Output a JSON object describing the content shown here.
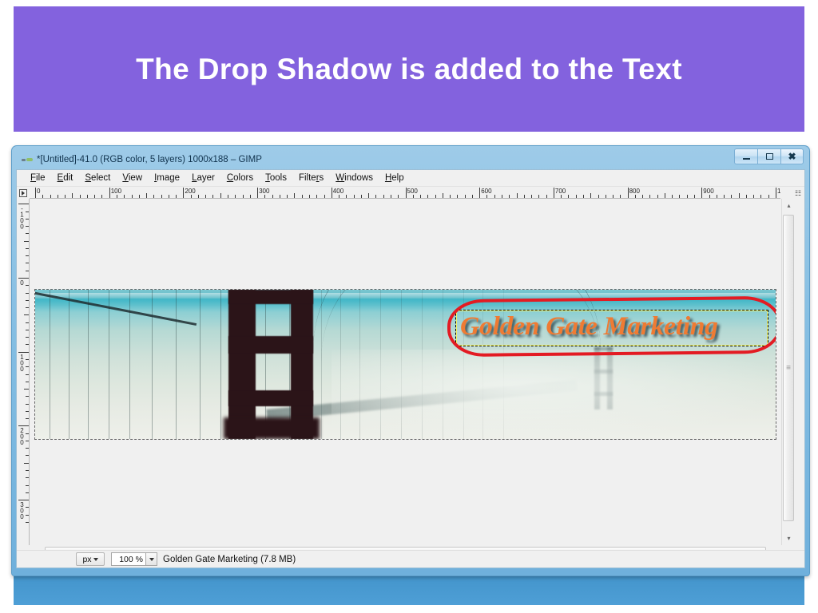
{
  "slide": {
    "title": "The Drop Shadow is added to the Text",
    "band_color": "#8362de",
    "footer_color": "#4596cd"
  },
  "window": {
    "title": "*[Untitled]-41.0 (RGB color, 5 layers) 1000x188 – GIMP",
    "app_icon": "gimp-icon",
    "controls": {
      "minimize": "–",
      "maximize": "□",
      "close": "✕"
    }
  },
  "menubar": {
    "items": [
      {
        "pre": "",
        "mnemonic": "F",
        "post": "ile"
      },
      {
        "pre": "",
        "mnemonic": "E",
        "post": "dit"
      },
      {
        "pre": "",
        "mnemonic": "S",
        "post": "elect"
      },
      {
        "pre": "",
        "mnemonic": "V",
        "post": "iew"
      },
      {
        "pre": "",
        "mnemonic": "I",
        "post": "mage"
      },
      {
        "pre": "",
        "mnemonic": "L",
        "post": "ayer"
      },
      {
        "pre": "",
        "mnemonic": "C",
        "post": "olors"
      },
      {
        "pre": "",
        "mnemonic": "T",
        "post": "ools"
      },
      {
        "pre": "Filte",
        "mnemonic": "r",
        "post": "s"
      },
      {
        "pre": "",
        "mnemonic": "W",
        "post": "indows"
      },
      {
        "pre": "",
        "mnemonic": "H",
        "post": "elp"
      }
    ]
  },
  "rulers": {
    "unit": "px",
    "horizontal_labels": [
      "0",
      "100",
      "200",
      "300",
      "400",
      "500",
      "600",
      "700",
      "800",
      "900"
    ],
    "vertical_labels": [
      "-100",
      "0",
      "100",
      "200",
      "300"
    ]
  },
  "canvas": {
    "image_size": "1000x188",
    "text_layer": {
      "text": "Golden Gate Marketing",
      "color": "#ef7b33",
      "shadow_color": "#192d37"
    },
    "annotation": {
      "shape": "red-oval",
      "color": "#e31b23"
    }
  },
  "statusbar": {
    "unit": "px",
    "zoom": "100 %",
    "message": "Golden Gate Marketing (7.8 MB)"
  },
  "scrollbars": {
    "left_arrow": "◂",
    "right_arrow": "▸",
    "up_arrow": "▴",
    "down_arrow": "▾",
    "navigate_icon": "✤"
  }
}
